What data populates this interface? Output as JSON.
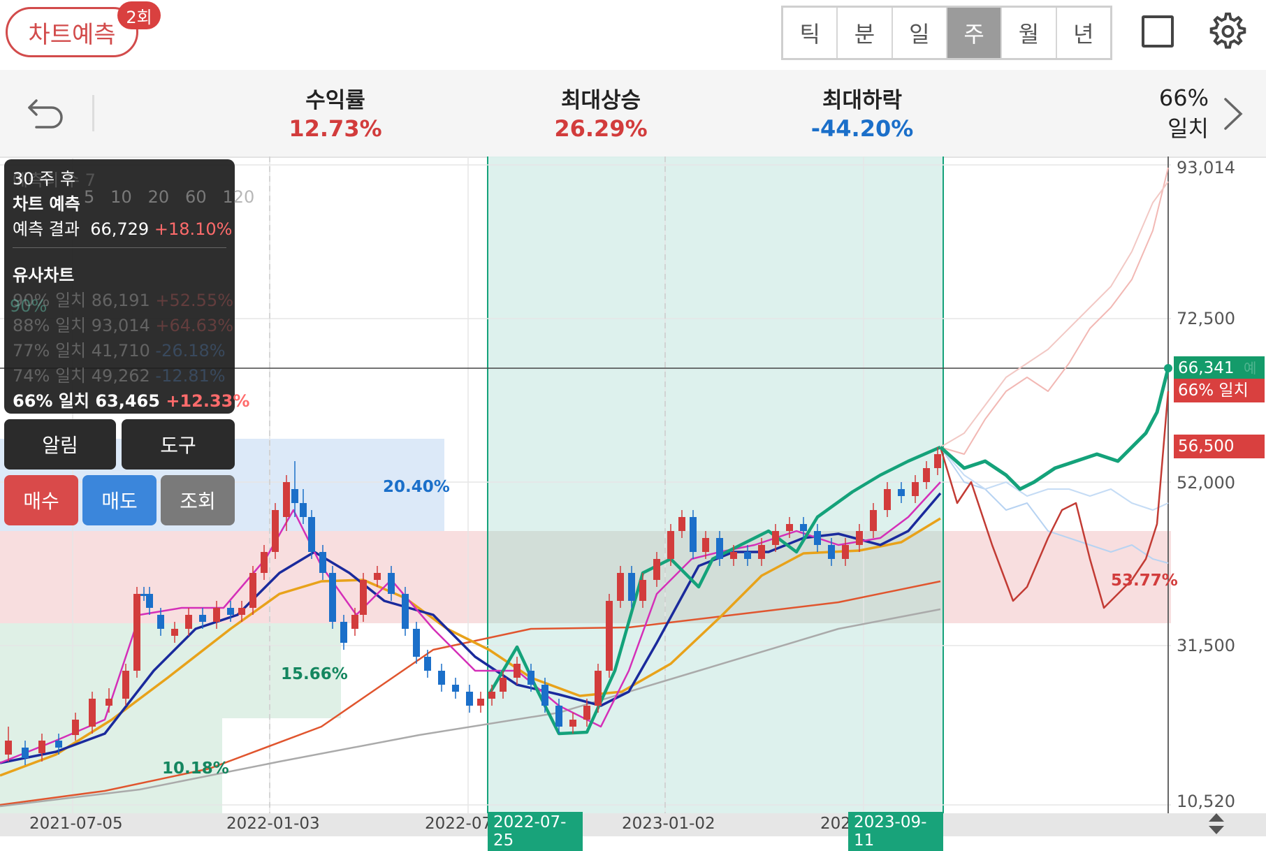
{
  "toolbar": {
    "predict_label": "차트예측",
    "predict_count": "2회",
    "periods": [
      "틱",
      "분",
      "일",
      "주",
      "월",
      "년"
    ],
    "active_period": "주"
  },
  "stats": {
    "return_label": "수익률",
    "return_value": "12.73%",
    "max_up_label": "최대상승",
    "max_up_value": "26.29%",
    "max_down_label": "최대하락",
    "max_down_value": "-44.20%",
    "match_pct": "66%",
    "match_word": "일치",
    "colors": {
      "up": "#d23c3c",
      "down": "#1b6fc9"
    }
  },
  "panel": {
    "ghost_header": "예측디 수 7",
    "ma_legend": [
      "5",
      "10",
      "20",
      "60",
      "120"
    ],
    "after": "30 주 후",
    "title": "차트 예측",
    "result_label": "예측 결과",
    "result_value": "66,729",
    "result_change": "+18.10%",
    "similar_title": "유사차트",
    "similar": [
      {
        "label": "90% 일치",
        "value": "86,191",
        "change": "+52.55%"
      },
      {
        "label": "88% 일치",
        "value": "93,014",
        "change": "+64.63%"
      },
      {
        "label": "77% 일치",
        "value": "41,710",
        "change": "-26.18%"
      },
      {
        "label": "74% 일치",
        "value": "49,262",
        "change": "-12.81%"
      },
      {
        "label": "66% 일치",
        "value": "63,465",
        "change": "+12.33%"
      }
    ],
    "ghost_90": "90%"
  },
  "actions": {
    "alert": "알림",
    "tools": "도구",
    "buy": "매수",
    "sell": "매도",
    "inquiry": "조회"
  },
  "chart": {
    "y_ticks": [
      "93,014",
      "72,500",
      "52,000",
      "31,500",
      "10,520"
    ],
    "x_ticks": [
      "2021-07-05",
      "2022-01-03",
      "2022-07",
      "2023-01-02",
      "202"
    ],
    "highlight_start": "2022-07-25",
    "highlight_end": "2023-09-11",
    "current_price_tag": "66,341",
    "current_ghost": "예측 결과",
    "match_tag": "66% 일치",
    "price_tag": "56,500",
    "zone_labels": [
      "20.40%",
      "15.66%",
      "10.18%",
      "53.77%"
    ],
    "colors": {
      "candle_up": "#d23c3c",
      "candle_down": "#1b6fc9",
      "ma5": "#d42fb8",
      "ma10": "#1a2a9c",
      "ma20": "#e8a21a",
      "ma60": "#e0552e",
      "ma120": "#aaaaaa",
      "pattern": "#14a27a",
      "highlight": "#d9f0eb",
      "highlight_border": "#14a27a"
    }
  }
}
